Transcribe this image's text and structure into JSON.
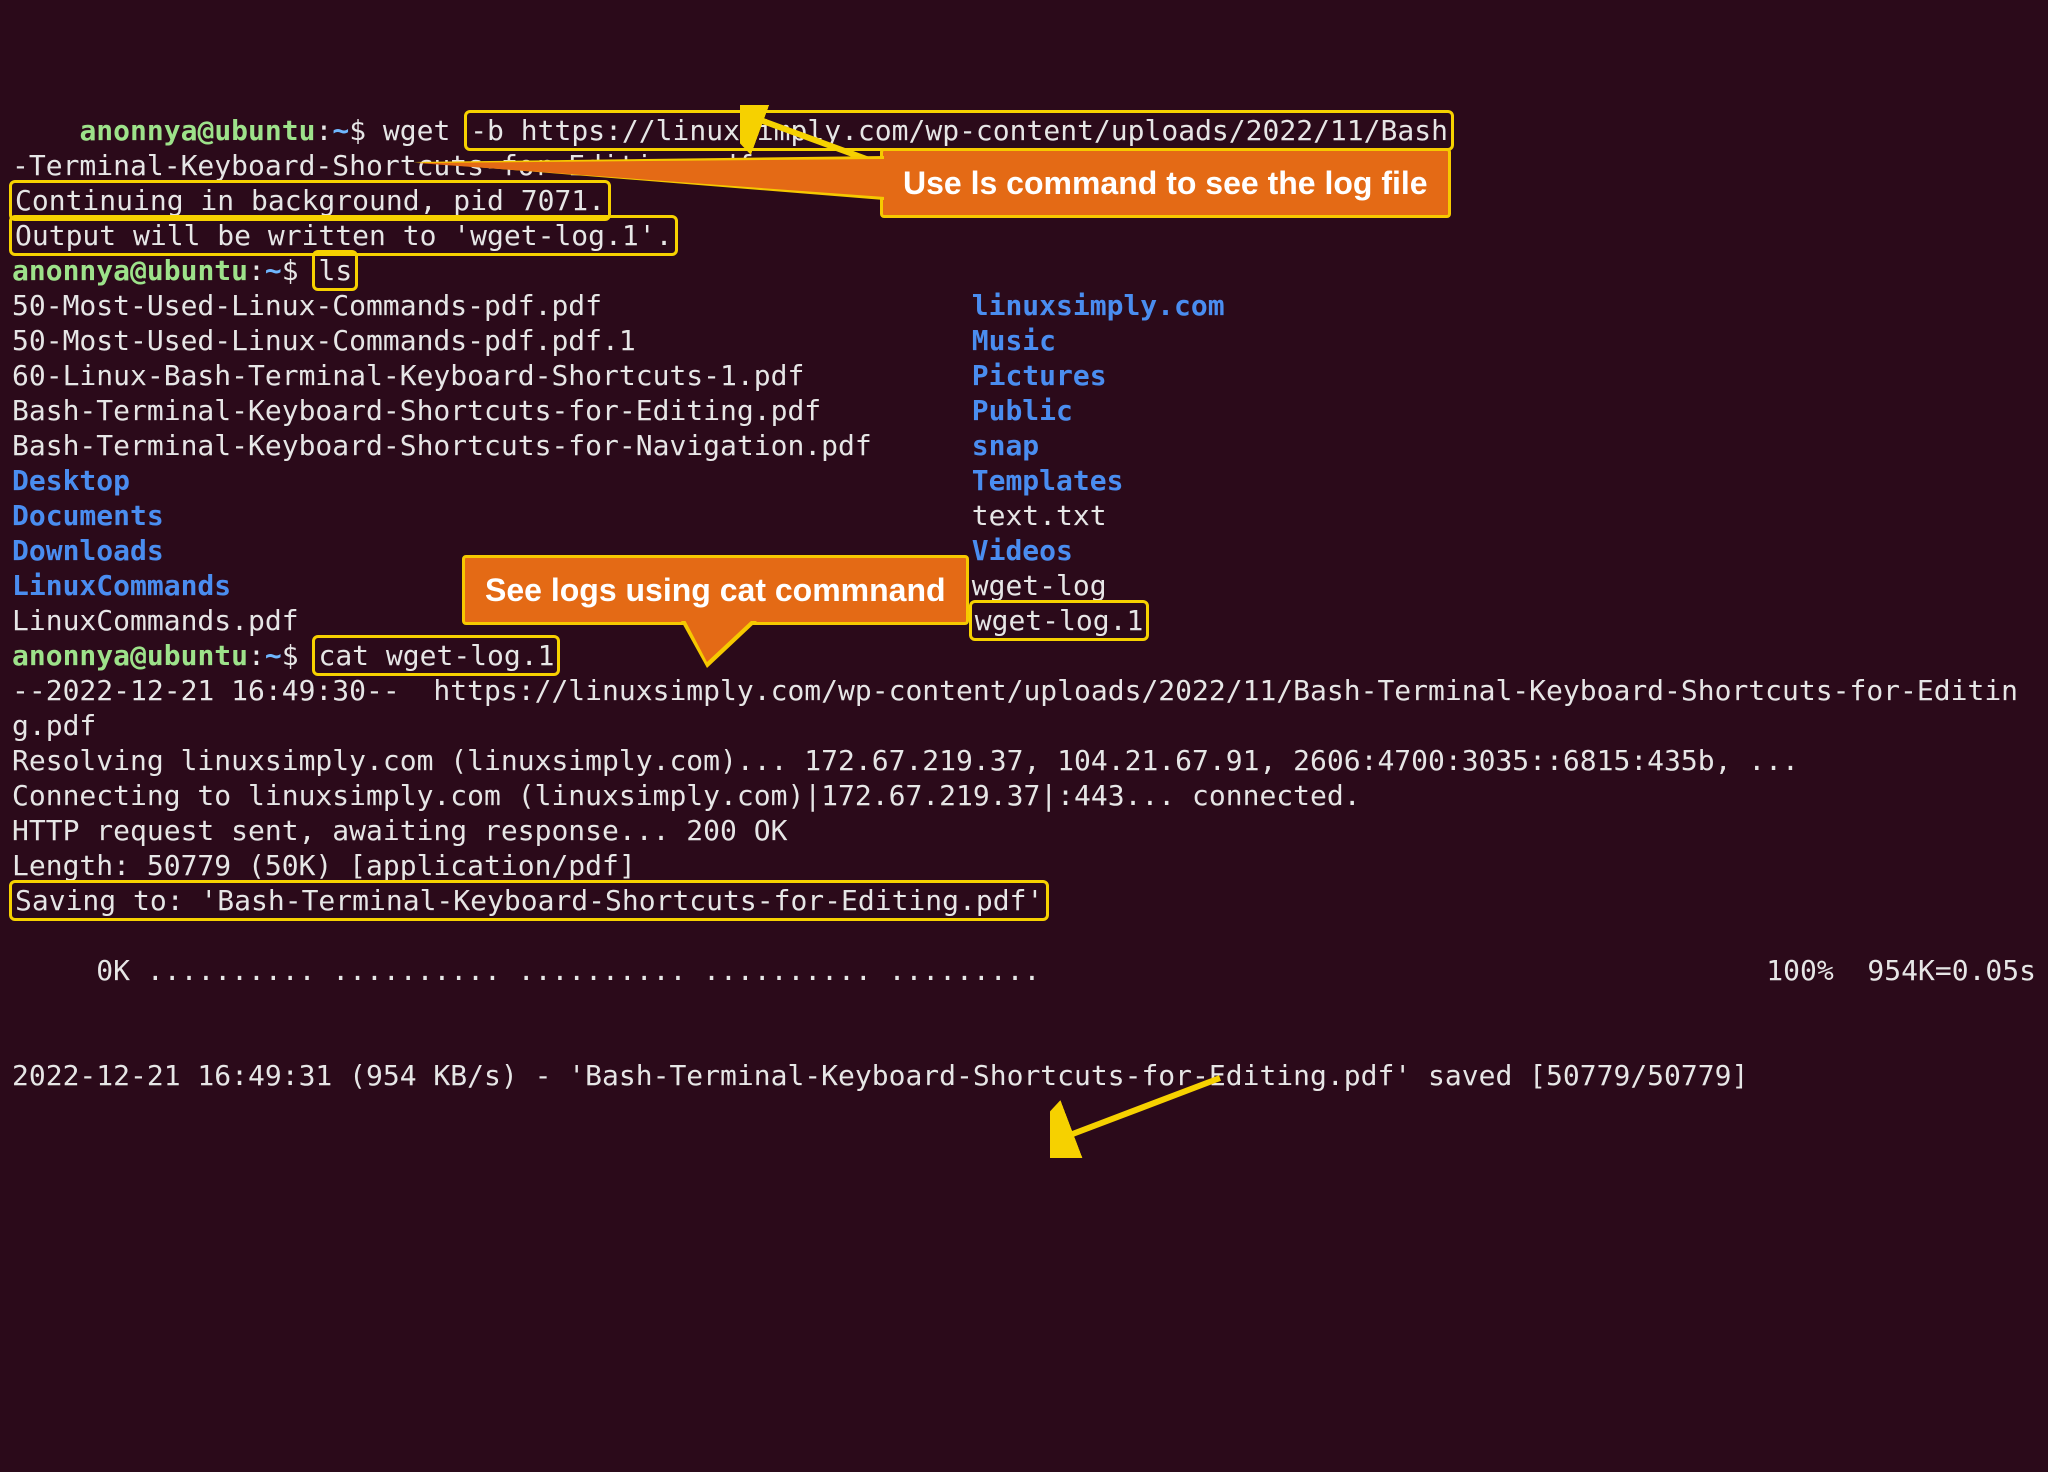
{
  "prompt": {
    "user": "anonnya",
    "host": "ubuntu",
    "sep_at": "@",
    "sep_colon": ":",
    "path": "~",
    "dollar": "$ "
  },
  "cmd1": {
    "prefix": "wget",
    "boxed": "-b https://linuxsimply.com/wp-content/uploads/2022/11/Bash",
    "wrap": "-Terminal-Keyboard-Shortcuts-for-Editing.pdf"
  },
  "wget_out": {
    "line1": "Continuing in background, pid 7071.",
    "line2": "Output will be written to 'wget-log.1'."
  },
  "cmd2": "ls",
  "ls": {
    "left": [
      {
        "name": "50-Most-Used-Linux-Commands-pdf.pdf",
        "dir": false
      },
      {
        "name": "50-Most-Used-Linux-Commands-pdf.pdf.1",
        "dir": false
      },
      {
        "name": "60-Linux-Bash-Terminal-Keyboard-Shortcuts-1.pdf",
        "dir": false
      },
      {
        "name": "Bash-Terminal-Keyboard-Shortcuts-for-Editing.pdf",
        "dir": false
      },
      {
        "name": "Bash-Terminal-Keyboard-Shortcuts-for-Navigation.pdf",
        "dir": false
      },
      {
        "name": "Desktop",
        "dir": true
      },
      {
        "name": "Documents",
        "dir": true
      },
      {
        "name": "Downloads",
        "dir": true
      },
      {
        "name": "LinuxCommands",
        "dir": true
      },
      {
        "name": "LinuxCommands.pdf",
        "dir": false
      }
    ],
    "right": [
      {
        "name": "linuxsimply.com",
        "dir": true
      },
      {
        "name": "Music",
        "dir": true
      },
      {
        "name": "Pictures",
        "dir": true
      },
      {
        "name": "Public",
        "dir": true
      },
      {
        "name": "snap",
        "dir": true
      },
      {
        "name": "Templates",
        "dir": true
      },
      {
        "name": "text.txt",
        "dir": false
      },
      {
        "name": "Videos",
        "dir": true
      },
      {
        "name": "wget-log",
        "dir": false
      },
      {
        "name": "wget-log.1",
        "dir": false,
        "boxed": true
      }
    ]
  },
  "cmd3": "cat wget-log.1",
  "log": {
    "l1": "--2022-12-21 16:49:30--  https://linuxsimply.com/wp-content/uploads/2022/11/Bash-Terminal-Keyboard-Shortcuts-for-Editing.pdf",
    "l2": "Resolving linuxsimply.com (linuxsimply.com)... 172.67.219.37, 104.21.67.91, 2606:4700:3035::6815:435b, ...",
    "l3": "Connecting to linuxsimply.com (linuxsimply.com)|172.67.219.37|:443... connected.",
    "l4": "HTTP request sent, awaiting response... 200 OK",
    "l5": "Length: 50779 (50K) [application/pdf]",
    "l6": "Saving to: 'Bash-Terminal-Keyboard-Shortcuts-for-Editing.pdf'",
    "progress_left": "     0K .......... .......... .......... .......... .........",
    "progress_right": "100%  954K=0.05s",
    "final": "2022-12-21 16:49:31 (954 KB/s) - 'Bash-Terminal-Keyboard-Shortcuts-for-Editing.pdf' saved [50779/50779]"
  },
  "annot": {
    "ls_hint": "Use ls command to see the log file",
    "cat_hint": "See logs using cat commnand"
  }
}
